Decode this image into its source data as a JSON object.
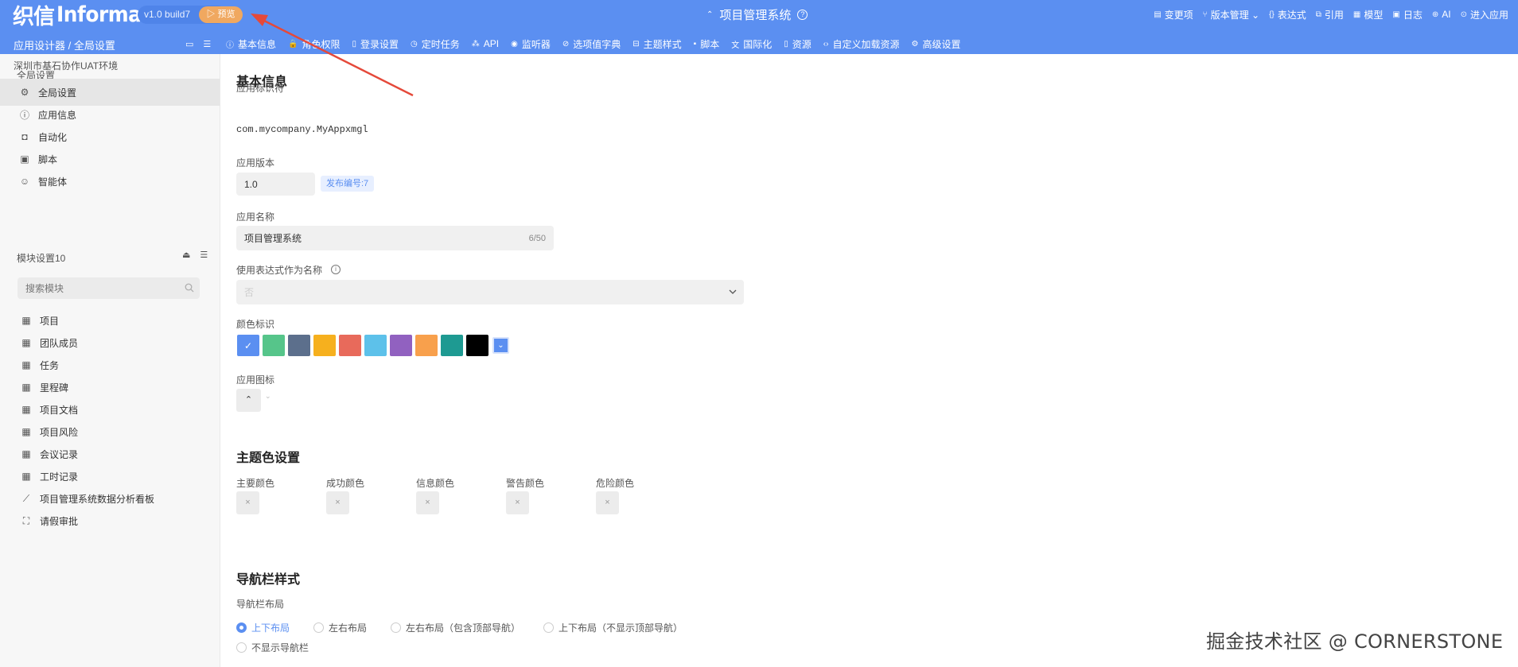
{
  "header": {
    "logo_cn": "织信",
    "logo_en": "Informat",
    "version": "v1.0 build7",
    "preview_label": "▷ 预览",
    "app_title": "项目管理系统",
    "right_items": [
      {
        "icon": "changes-icon",
        "glyph": "▤",
        "label": "变更项"
      },
      {
        "icon": "version-icon",
        "glyph": "⑂",
        "label": "版本管理 ⌄"
      },
      {
        "icon": "braces-icon",
        "glyph": "{}",
        "label": "表达式"
      },
      {
        "icon": "reference-icon",
        "glyph": "⧉",
        "label": "引用"
      },
      {
        "icon": "grid-icon",
        "glyph": "▦",
        "label": "模型"
      },
      {
        "icon": "log-icon",
        "glyph": "▣",
        "label": "日志"
      },
      {
        "icon": "ai-icon",
        "glyph": "⊕",
        "label": "AI"
      },
      {
        "icon": "enter-icon",
        "glyph": "⊙",
        "label": "进入应用"
      }
    ],
    "breadcrumb": "应用设计器 / 全局设置",
    "tabs": [
      {
        "icon": "info-icon",
        "glyph": "ⓘ",
        "label": "基本信息"
      },
      {
        "icon": "lock-icon",
        "glyph": "🔒",
        "label": "角色权限"
      },
      {
        "icon": "login-icon",
        "glyph": "▯",
        "label": "登录设置"
      },
      {
        "icon": "clock-icon",
        "glyph": "◷",
        "label": "定时任务"
      },
      {
        "icon": "api-icon",
        "glyph": "⁂",
        "label": "API"
      },
      {
        "icon": "listener-icon",
        "glyph": "◉",
        "label": "监听器"
      },
      {
        "icon": "options-icon",
        "glyph": "⊘",
        "label": "选项值字典"
      },
      {
        "icon": "theme-icon",
        "glyph": "⊟",
        "label": "主题样式"
      },
      {
        "icon": "script-icon",
        "glyph": "▪",
        "label": "脚本"
      },
      {
        "icon": "i18n-icon",
        "glyph": "文",
        "label": "国际化"
      },
      {
        "icon": "resource-icon",
        "glyph": "▯",
        "label": "资源"
      },
      {
        "icon": "code-icon",
        "glyph": "‹›",
        "label": "自定义加载资源"
      },
      {
        "icon": "settings-icon",
        "glyph": "⚙",
        "label": "高级设置"
      }
    ]
  },
  "sidebar": {
    "env": "深圳市基石协作UAT环境",
    "global_title": "全局设置",
    "global_items": [
      {
        "icon": "gear-icon",
        "glyph": "⚙",
        "label": "全局设置",
        "active": true
      },
      {
        "icon": "info-icon",
        "glyph": "ⓘ",
        "label": "应用信息"
      },
      {
        "icon": "robot-icon",
        "glyph": "◘",
        "label": "自动化"
      },
      {
        "icon": "script-icon",
        "glyph": "▣",
        "label": "脚本"
      },
      {
        "icon": "agent-icon",
        "glyph": "☺",
        "label": "智能体"
      }
    ],
    "module_title": "模块设置10",
    "search_placeholder": "搜索模块",
    "modules": [
      {
        "icon": "table-icon",
        "glyph": "▦",
        "label": "项目"
      },
      {
        "icon": "table-icon",
        "glyph": "▦",
        "label": "团队成员"
      },
      {
        "icon": "table-icon",
        "glyph": "▦",
        "label": "任务"
      },
      {
        "icon": "table-icon",
        "glyph": "▦",
        "label": "里程碑"
      },
      {
        "icon": "table-icon",
        "glyph": "▦",
        "label": "项目文档"
      },
      {
        "icon": "table-icon",
        "glyph": "▦",
        "label": "项目风险"
      },
      {
        "icon": "table-icon",
        "glyph": "▦",
        "label": "会议记录"
      },
      {
        "icon": "table-icon",
        "glyph": "▦",
        "label": "工时记录"
      },
      {
        "icon": "chart-icon",
        "glyph": "⟋",
        "label": "项目管理系统数据分析看板"
      },
      {
        "icon": "flow-icon",
        "glyph": "⛶",
        "label": "请假审批"
      }
    ]
  },
  "main": {
    "basic_title": "基本信息",
    "app_id_label": "应用标识符",
    "app_id_value": "com.mycompany.MyAppxmgl",
    "version_label": "应用版本",
    "version_value": "1.0",
    "release_tag": "发布编号:7",
    "name_label": "应用名称",
    "name_value": "项目管理系统",
    "name_counter": "6/50",
    "expr_label": "使用表达式作为名称",
    "expr_value": "否",
    "color_label": "颜色标识",
    "colors": [
      "#5b8ff1",
      "#56c58a",
      "#5c6f8c",
      "#f6b01e",
      "#e86a5b",
      "#5dc1ea",
      "#9161c0",
      "#f8a04c",
      "#1e9a92",
      "#000000"
    ],
    "icon_label": "应用图标",
    "theme_title": "主题色设置",
    "theme_colors": [
      {
        "label": "主要颜色",
        "value": "×"
      },
      {
        "label": "成功颜色",
        "value": "×"
      },
      {
        "label": "信息颜色",
        "value": "×"
      },
      {
        "label": "警告颜色",
        "value": "×"
      },
      {
        "label": "危险颜色",
        "value": "×"
      }
    ],
    "nav_title": "导航栏样式",
    "nav_layout_label": "导航栏布局",
    "nav_options": [
      {
        "label": "上下布局",
        "selected": true
      },
      {
        "label": "左右布局"
      },
      {
        "label": "左右布局（包含顶部导航）"
      },
      {
        "label": "上下布局（不显示顶部导航）"
      },
      {
        "label": "不显示导航栏"
      }
    ]
  },
  "watermark": "掘金技术社区 @ CORNERSTONE",
  "accent_color": "#5b8ff1"
}
